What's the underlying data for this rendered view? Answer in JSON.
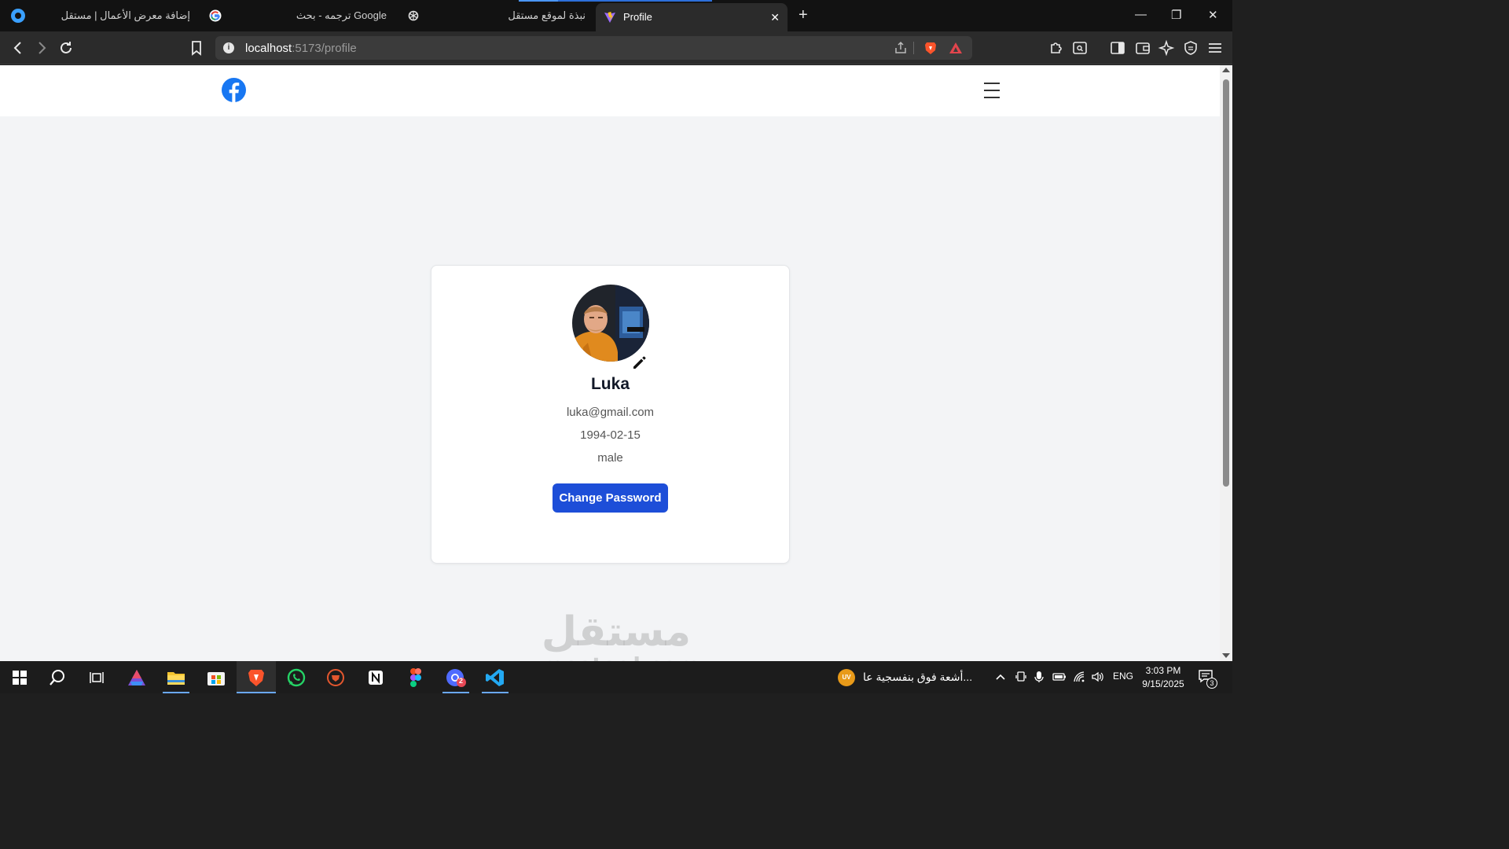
{
  "browser": {
    "tabs": [
      {
        "title": "إضافة معرض الأعمال | مستقل",
        "favicon": "mostaql-favicon-icon",
        "active": false
      },
      {
        "title": "ترجمه - بحث Google",
        "favicon": "google-favicon-icon",
        "active": false
      },
      {
        "title": "نبذة لموقع مستقل",
        "favicon": "chatgpt-favicon-icon",
        "active": false
      },
      {
        "title": "Profile",
        "favicon": "vite-favicon-icon",
        "active": true
      }
    ],
    "close_tab_glyph": "✕",
    "new_tab_glyph": "+",
    "window_controls": {
      "minimize": "—",
      "restore": "❐",
      "close": "✕"
    },
    "address": {
      "host": "localhost",
      "rest": ":5173/profile"
    }
  },
  "page": {
    "user": {
      "name": "Luka",
      "email": "luka@gmail.com",
      "birthdate": "1994-02-15",
      "gender": "male"
    },
    "change_password_label": "Change Password",
    "accent_color": "#1d4ed8",
    "brand_color": "#1877f2"
  },
  "watermark": {
    "arabic": "مستقل",
    "latin": "mostaql.com"
  },
  "taskbar": {
    "news_badge": "UV",
    "news_text": "أشعة فوق بنفسجية عا...",
    "language": "ENG",
    "time": "3:03 PM",
    "date": "9/15/2025",
    "notification_count": "3",
    "chrome_badge": "2"
  }
}
